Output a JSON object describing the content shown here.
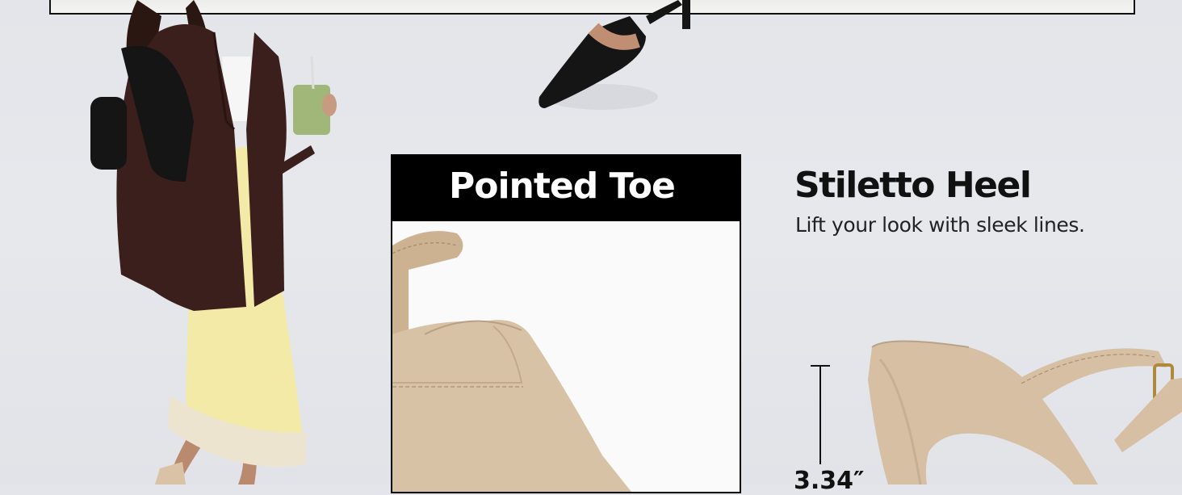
{
  "feature_toe": {
    "title": "Pointed Toe"
  },
  "feature_heel": {
    "title": "Stiletto Heel",
    "subtitle": "Lift your look with sleek lines.",
    "height_label": "3.34″"
  },
  "colors": {
    "background": "#e4e6eb",
    "header_black": "#000000",
    "shoe_nude": "#d8c2a6",
    "shoe_black": "#151515"
  }
}
